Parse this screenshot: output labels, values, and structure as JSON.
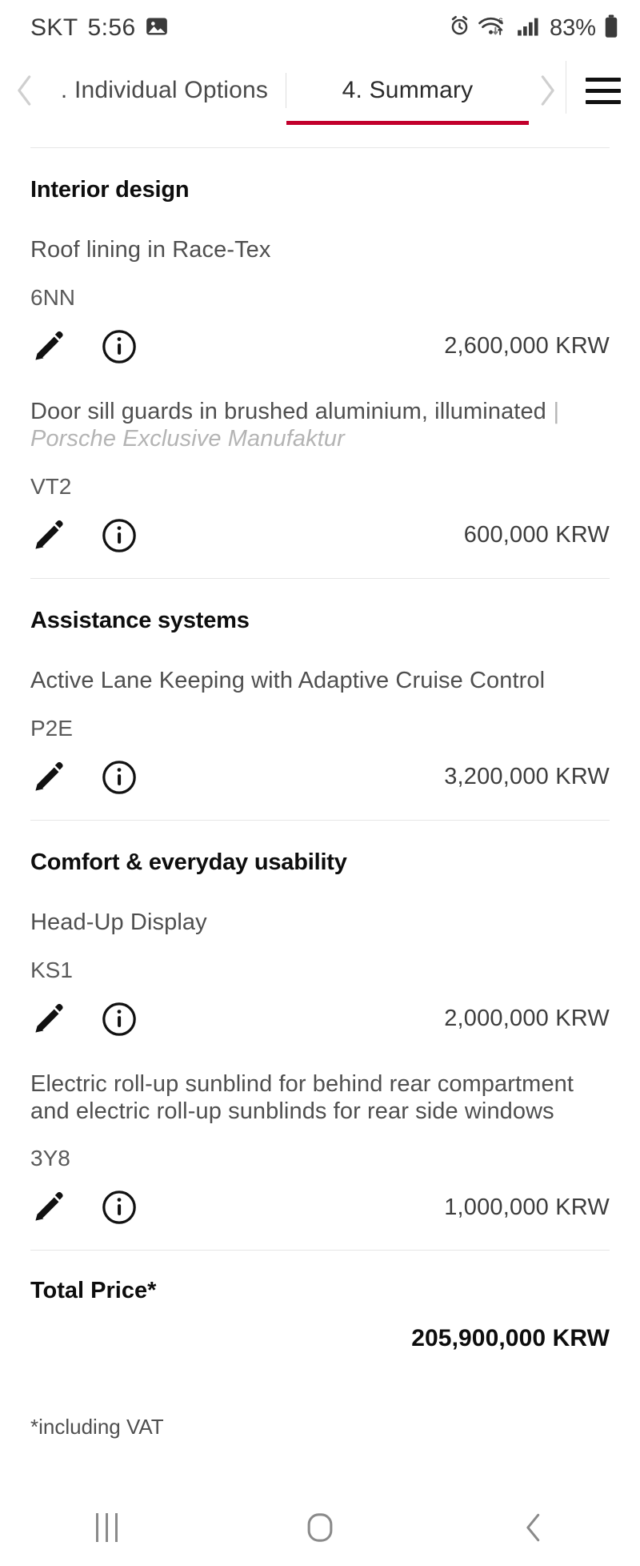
{
  "status_bar": {
    "carrier": "SKT",
    "time": "5:56",
    "image_icon": "image-icon",
    "alarm_icon": "alarm-clock-icon",
    "wifi_icon": "wifi-6-icon",
    "signal_icon": "cellular-signal-icon",
    "battery_percent": "83%",
    "battery_icon": "battery-icon"
  },
  "header": {
    "prev_arrow": "chevron-left-icon",
    "next_arrow": "chevron-right-icon",
    "menu_icon": "hamburger-menu-icon",
    "accent_color": "#c2002c",
    "tabs": [
      {
        "label": ". Individual Options",
        "active": false
      },
      {
        "label": "4. Summary",
        "active": true
      }
    ]
  },
  "sections": [
    {
      "title": "Interior design",
      "options": [
        {
          "name": "Roof lining in Race-Tex",
          "suffix": "",
          "code": "6NN",
          "price": "2,600,000 KRW",
          "edit_icon": "pencil-edit-icon",
          "info_icon": "info-circle-icon"
        },
        {
          "name": "Door sill guards in brushed aluminium, illuminated",
          "suffix": "| Porsche Exclusive Manufaktur",
          "code": "VT2",
          "price": "600,000 KRW",
          "edit_icon": "pencil-edit-icon",
          "info_icon": "info-circle-icon"
        }
      ]
    },
    {
      "title": "Assistance systems",
      "options": [
        {
          "name": "Active Lane Keeping with Adaptive Cruise Control",
          "suffix": "",
          "code": "P2E",
          "price": "3,200,000 KRW",
          "edit_icon": "pencil-edit-icon",
          "info_icon": "info-circle-icon"
        }
      ]
    },
    {
      "title": "Comfort & everyday usability",
      "options": [
        {
          "name": "Head-Up Display",
          "suffix": "",
          "code": "KS1",
          "price": "2,000,000 KRW",
          "edit_icon": "pencil-edit-icon",
          "info_icon": "info-circle-icon"
        },
        {
          "name": "Electric roll-up sunblind for behind rear compartment and electric roll-up sunblinds for rear side windows",
          "suffix": "",
          "code": "3Y8",
          "price": "1,000,000 KRW",
          "edit_icon": "pencil-edit-icon",
          "info_icon": "info-circle-icon"
        }
      ]
    }
  ],
  "total": {
    "label": "Total Price*",
    "value": "205,900,000 KRW",
    "note": "*including VAT"
  },
  "navbar": {
    "recents_icon": "recents-icon",
    "home_icon": "home-icon",
    "back_icon": "back-icon"
  }
}
